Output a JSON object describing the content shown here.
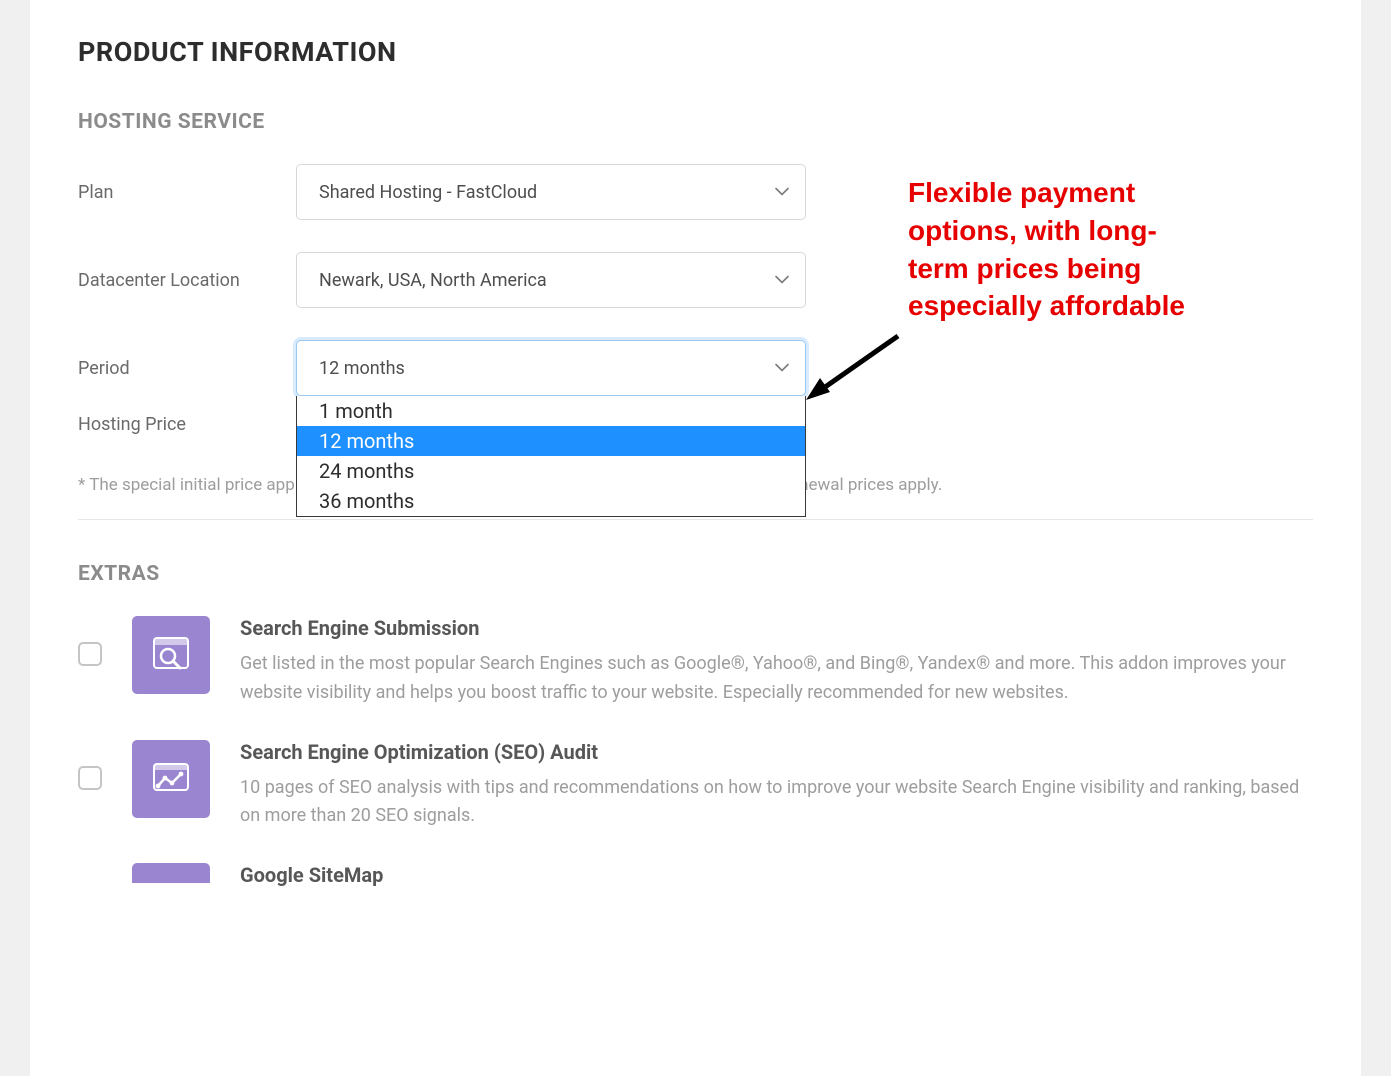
{
  "title": "PRODUCT INFORMATION",
  "hosting": {
    "section_title": "HOSTING SERVICE",
    "plan": {
      "label": "Plan",
      "value": "Shared Hosting - FastCloud"
    },
    "datacenter": {
      "label": "Datacenter Location",
      "value": "Newark, USA, North America"
    },
    "period": {
      "label": "Period",
      "value": "12 months",
      "options": [
        "1 month",
        "12 months",
        "24 months",
        "36 months"
      ],
      "highlighted_index": 1
    },
    "price": {
      "label": "Hosting Price"
    },
    "disclaimer": "* The special initial price applies for the first invoice only. Once your initial term is over regular renewal prices apply."
  },
  "extras": {
    "section_title": "EXTRAS",
    "items": [
      {
        "title": "Search Engine Submission",
        "desc": "Get listed in the most popular Search Engines such as Google®, Yahoo®, and Bing®, Yandex® and more. This addon improves your website visibility and helps you boost traffic to your website. Especially recommended for new websites."
      },
      {
        "title": "Search Engine Optimization (SEO) Audit",
        "desc": "10 pages of SEO analysis with tips and recommendations on how to improve your website Search Engine visibility and ranking, based on more than 20 SEO signals."
      },
      {
        "title": "Google SiteMap",
        "desc": ""
      }
    ]
  },
  "annotation": {
    "text": "Flexible payment options, with long-term prices being especially affordable"
  }
}
